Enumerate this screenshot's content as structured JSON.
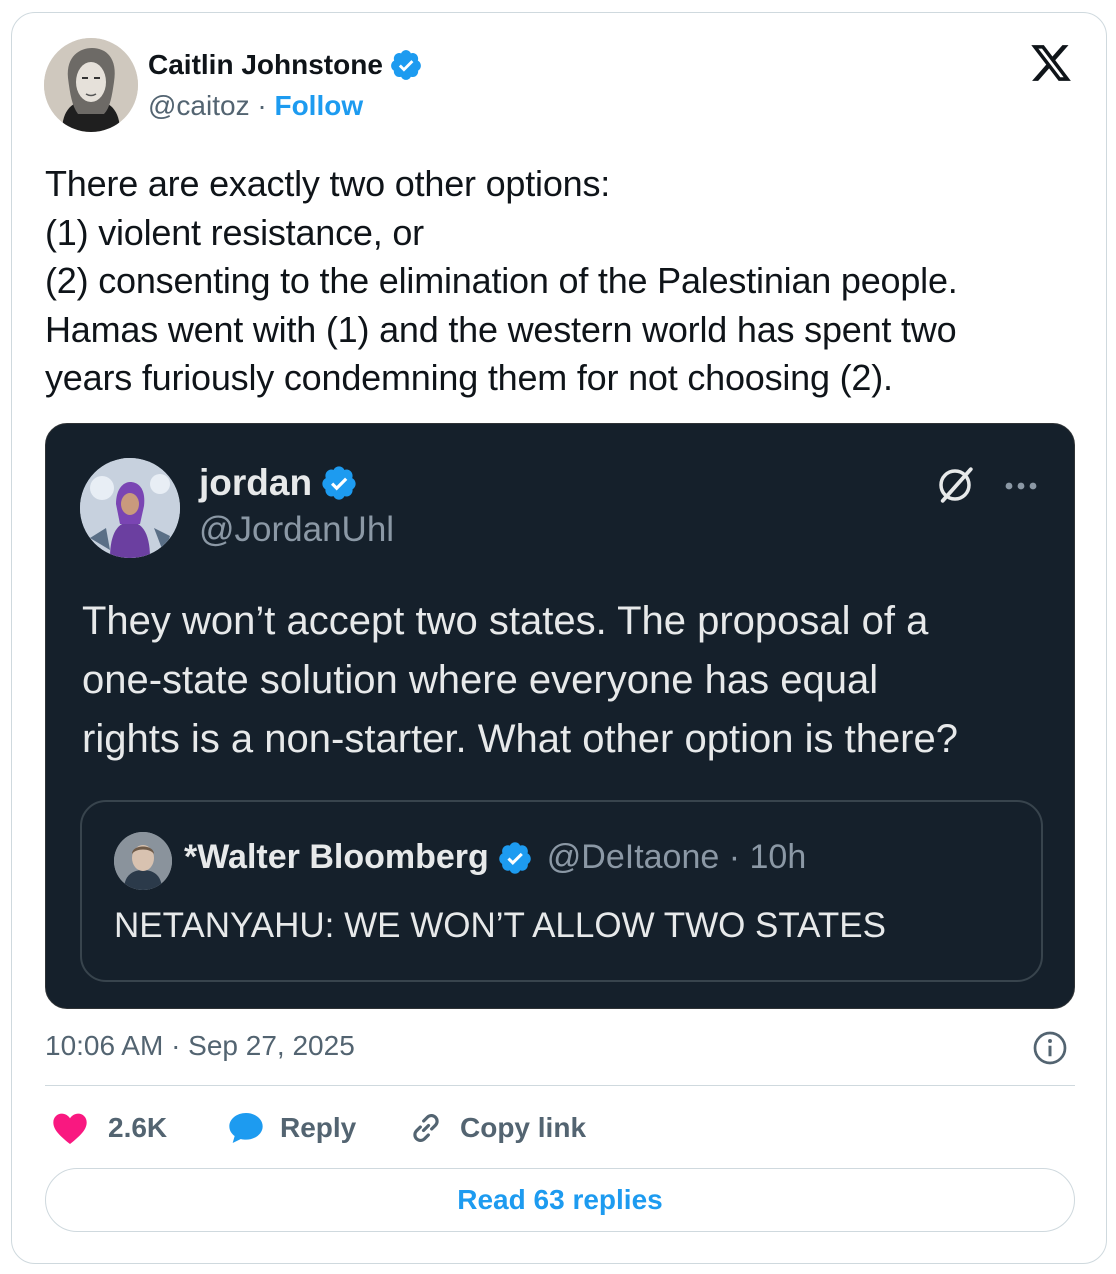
{
  "author": {
    "name": "Caitlin Johnstone",
    "handle": "@caitoz",
    "separator": "·",
    "follow_label": "Follow"
  },
  "tweet": {
    "text": "There are exactly two other options:\n(1) violent resistance, or\n(2) consenting to the elimination of the Palestinian people.\nHamas went with (1) and the western world has spent two\nyears furiously condemning them for not choosing (2).",
    "timestamp": "10:06 AM · Sep 27, 2025"
  },
  "quoted_tweet": {
    "name": "jordan",
    "handle": "@JordanUhl",
    "text": "They won’t accept two states. The proposal of a\none-state solution where everyone has equal\nrights is a non-starter. What other option is there?",
    "inner_quote": {
      "name": "*Walter Bloomberg",
      "handle_time": "@DeItaone · 10h",
      "text": "NETANYAHU: WE WON’T ALLOW TWO STATES"
    }
  },
  "actions": {
    "like_count": "2.6K",
    "reply_label": "Reply",
    "copy_label": "Copy link",
    "read_replies_label": "Read 63 replies"
  },
  "colors": {
    "accent": "#1d9bf0",
    "like": "#f91880",
    "quote_background": "#15202b",
    "muted_text": "#536471"
  },
  "icons": [
    "x-logo-icon",
    "verified-badge-icon",
    "grok-icon",
    "more-icon",
    "info-icon",
    "heart-icon",
    "reply-icon",
    "link-icon"
  ]
}
